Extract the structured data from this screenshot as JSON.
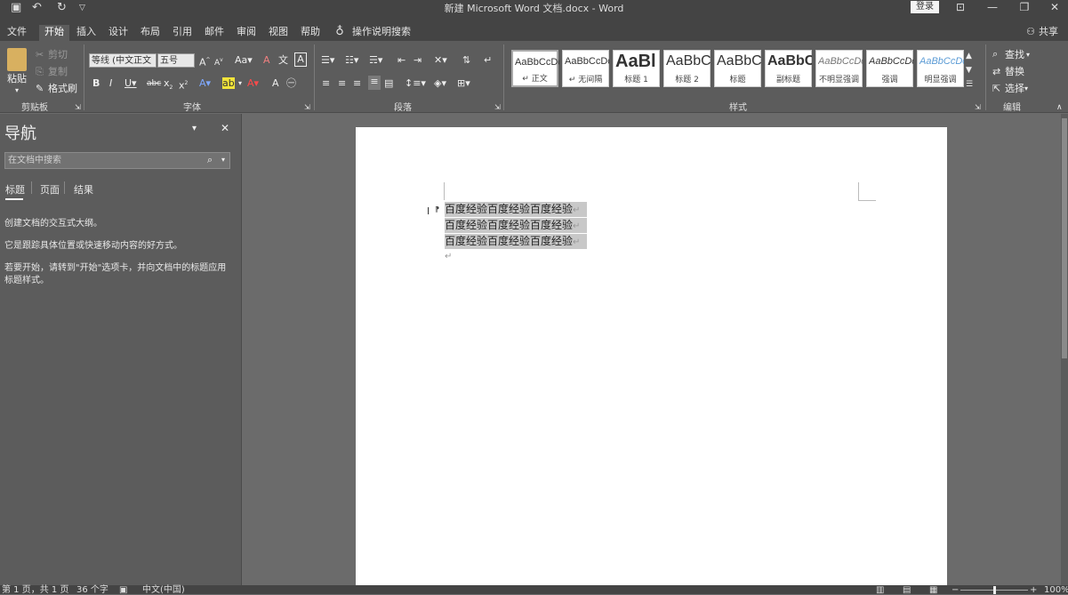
{
  "window": {
    "title": "新建 Microsoft Word 文档.docx  -  Word",
    "login": "登录"
  },
  "menu": {
    "tabs": [
      "文件",
      "开始",
      "插入",
      "设计",
      "布局",
      "引用",
      "邮件",
      "审阅",
      "视图",
      "帮助"
    ],
    "tell_me": "操作说明搜索",
    "share": "共享"
  },
  "ribbon": {
    "clipboard": {
      "paste": "粘贴",
      "cut": "剪切",
      "copy": "复制",
      "format_painter": "格式刷",
      "label": "剪贴板"
    },
    "font": {
      "name": "等线 (中文正文",
      "size": "五号",
      "label": "字体"
    },
    "paragraph": {
      "label": "段落"
    },
    "styles": {
      "label": "样式",
      "items": [
        {
          "sample": "AaBbCcDc",
          "name": "↵ 正文"
        },
        {
          "sample": "AaBbCcDc",
          "name": "↵ 无间隔"
        },
        {
          "sample": "AaBl",
          "name": "标题 1"
        },
        {
          "sample": "AaBbC",
          "name": "标题 2"
        },
        {
          "sample": "AaBbC",
          "name": "标题"
        },
        {
          "sample": "AaBbC",
          "name": "副标题"
        },
        {
          "sample": "AaBbCcDc",
          "name": "不明显强调"
        },
        {
          "sample": "AaBbCcDc",
          "name": "强调"
        },
        {
          "sample": "AaBbCcDc",
          "name": "明显强调"
        }
      ]
    },
    "editing": {
      "find": "查找",
      "replace": "替换",
      "select": "选择",
      "label": "编辑"
    }
  },
  "nav": {
    "title": "导航",
    "search_placeholder": "在文档中搜索",
    "tabs": [
      "标题",
      "页面",
      "结果"
    ],
    "help": [
      "创建文档的交互式大纲。",
      "它是跟踪具体位置或快速移动内容的好方式。",
      "若要开始，请转到\"开始\"选项卡，并向文档中的标题应用标题样式。"
    ]
  },
  "document": {
    "lines": [
      "百度经验百度经验百度经验",
      "百度经验百度经验百度经验",
      "百度经验百度经验百度经验"
    ]
  },
  "status": {
    "page": "第 1 页，共 1 页",
    "words": "36 个字",
    "language": "中文(中国)",
    "zoom": "100%"
  }
}
